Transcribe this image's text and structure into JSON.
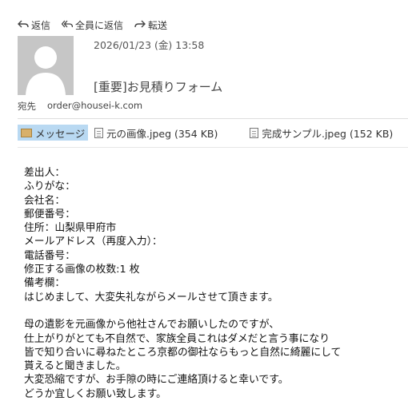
{
  "toolbar": {
    "reply": "返信",
    "reply_all": "全員に返信",
    "forward": "転送"
  },
  "header": {
    "date": "2026/01/23 (金) 13:58",
    "subject": "[重要]お見積りフォーム",
    "to_label": "宛先",
    "to_address": "order@housei-k.com"
  },
  "attachments": {
    "message_tab": "メッセージ",
    "file1": "元の画像.jpeg (354 KB)",
    "file2": "完成サンプル.jpeg (152 KB)"
  },
  "body": {
    "lines": [
      "差出人：",
      "ふりがな：",
      "会社名：",
      "郵便番号：",
      "住所：山梨県甲府市",
      "メールアドレス（再度入力）：",
      "電話番号：",
      "修正する画像の枚数:1 枚",
      "備考欄：",
      "はじめまして、大変失礼ながらメールさせて頂きます。",
      "",
      "母の遺影を元画像から他社さんでお願いしたのですが、",
      "仕上がりがとても不自然で、家族全員これはダメだと言う事になり",
      "皆で知り合いに尋ねたところ京都の御社ならもっと自然に綺麗にして",
      "貰えると聞きました。",
      "大変恐縮ですが、お手隙の時にご連絡頂けると幸いです。",
      "どうか宜しくお願い致します。"
    ]
  }
}
